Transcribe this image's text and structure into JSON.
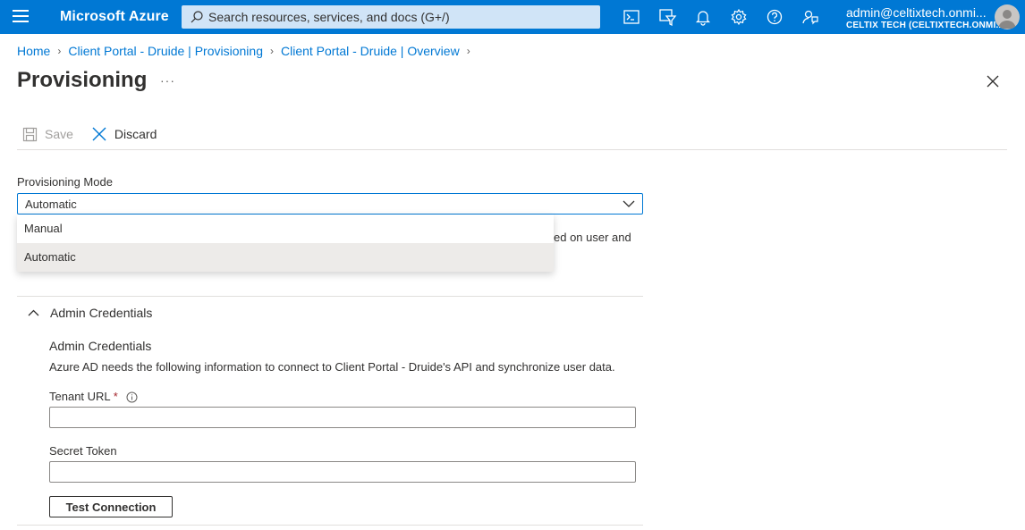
{
  "topbar": {
    "brand": "Microsoft Azure",
    "search_placeholder": "Search resources, services, and docs (G+/)",
    "account_email": "admin@celtixtech.onmi...",
    "account_tenant": "CELTIX TECH (CELTIXTECH.ONMI...",
    "icons": [
      "cloud-shell-icon",
      "directory-filter-icon",
      "notifications-icon",
      "settings-icon",
      "help-icon",
      "feedback-icon"
    ],
    "color": "#0078d4"
  },
  "breadcrumb": [
    {
      "label": "Home"
    },
    {
      "label": "Client Portal - Druide | Provisioning"
    },
    {
      "label": "Client Portal - Druide | Overview"
    }
  ],
  "page": {
    "title": "Provisioning",
    "more": "···"
  },
  "toolbar": {
    "save_label": "Save",
    "discard_label": "Discard"
  },
  "provisioning_mode": {
    "label": "Provisioning Mode",
    "selected": "Automatic",
    "options": [
      "Manual",
      "Automatic"
    ],
    "partial_description": "ed on user and"
  },
  "admin_credentials": {
    "section_title": "Admin Credentials",
    "heading": "Admin Credentials",
    "description": "Azure AD needs the following information to connect to Client Portal - Druide's API and synchronize user data.",
    "tenant_url_label": "Tenant URL",
    "required_mark": "*",
    "tenant_url_value": "",
    "secret_token_label": "Secret Token",
    "secret_token_value": "",
    "test_button": "Test Connection"
  }
}
